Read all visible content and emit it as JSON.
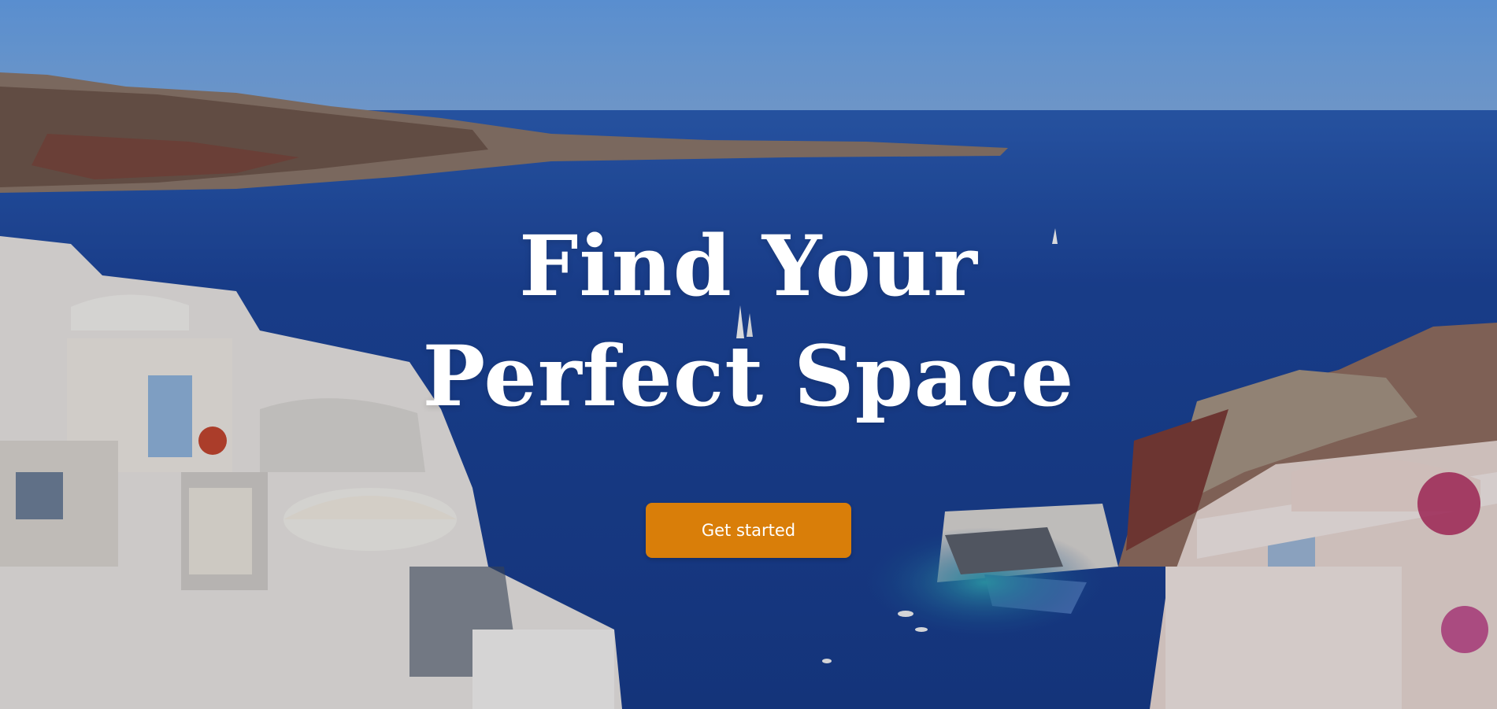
{
  "hero": {
    "title_line1": "Find Your",
    "title_line2": "Perfect Space",
    "cta_label": "Get started"
  },
  "colors": {
    "accent": "#d97e09",
    "sky": "#6ea6e4",
    "sea": "#1a3f8c",
    "text": "#ffffff"
  }
}
